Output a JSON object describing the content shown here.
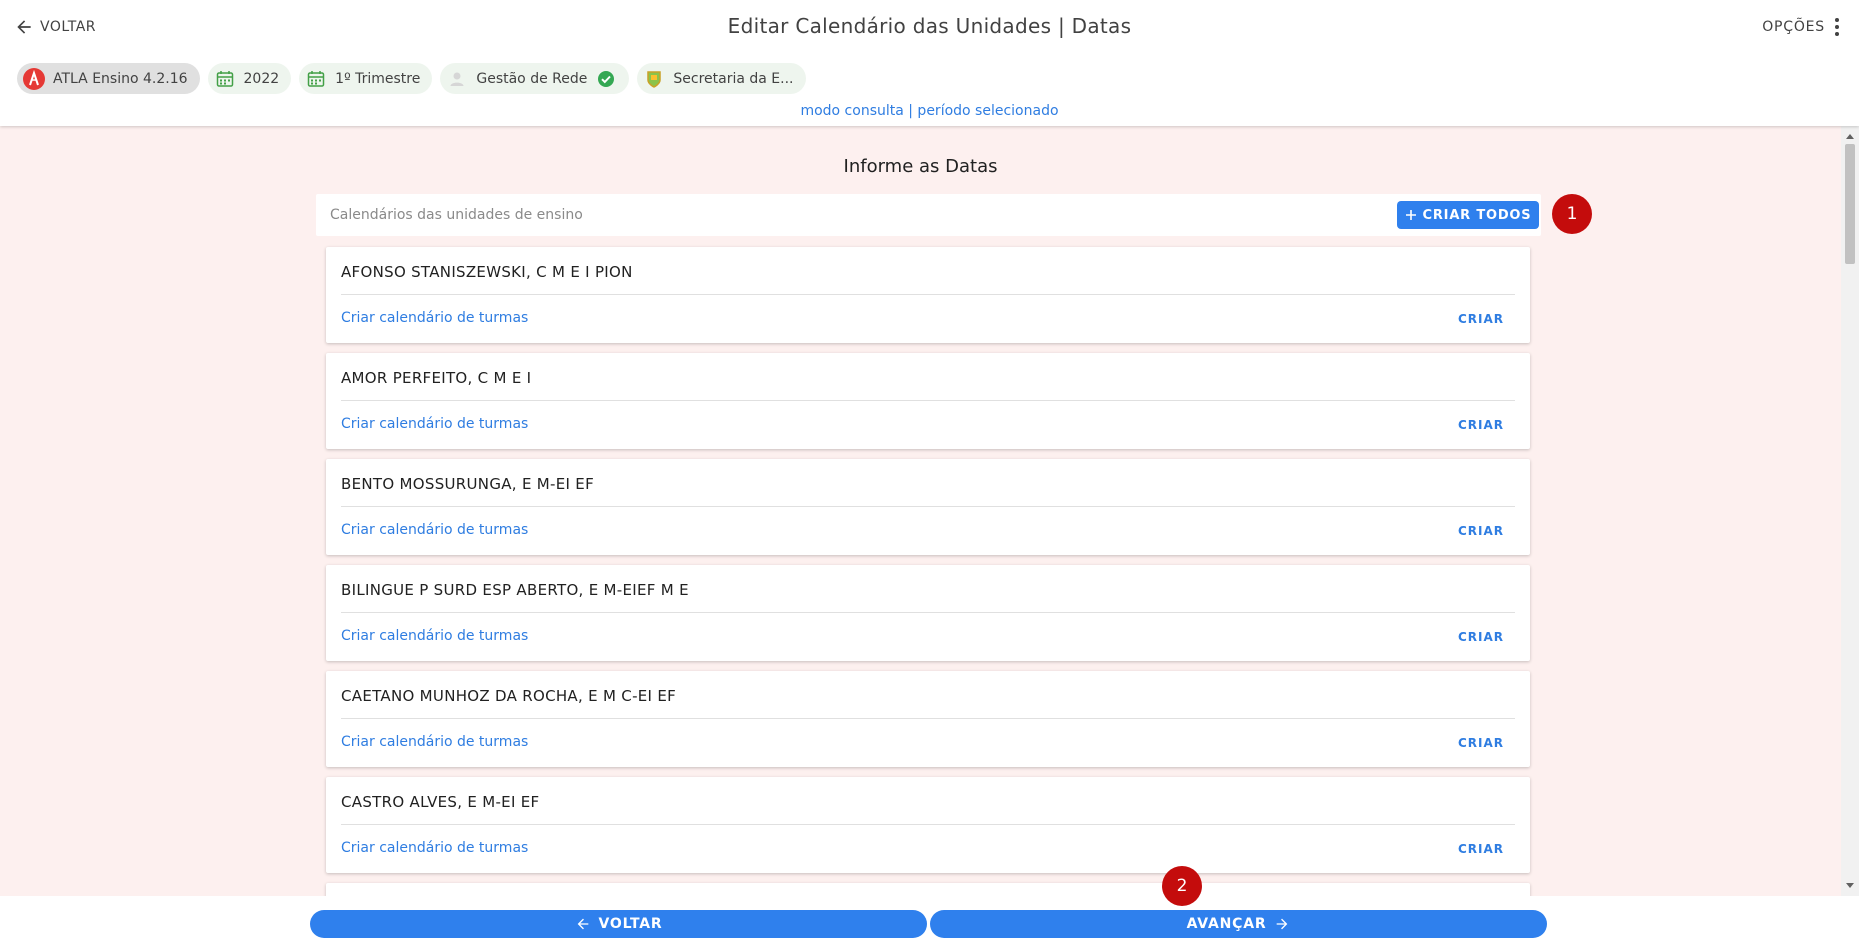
{
  "header": {
    "back_label": "VOLTAR",
    "title": "Editar Calendário das Unidades | Datas",
    "options_label": "OPÇÕES",
    "mode_link": "modo consulta | período selecionado"
  },
  "chips": [
    {
      "label": "ATLA Ensino 4.2.16",
      "icon": "atla-logo-icon"
    },
    {
      "label": "2022",
      "icon": "calendar-icon"
    },
    {
      "label": "1º Trimestre",
      "icon": "calendar-icon"
    },
    {
      "label": "Gestão de Rede",
      "icon": "person-icon",
      "status_icon": "check-circle-icon"
    },
    {
      "label": "Secretaria da E...",
      "icon": "crest-icon"
    }
  ],
  "main": {
    "section_title": "Informe as Datas",
    "search_placeholder": "Calendários das unidades de ensino",
    "criar_todos_label": "CRIAR TODOS"
  },
  "badges": [
    "1",
    "2"
  ],
  "cards": [
    {
      "title": "AFONSO STANISZEWSKI, C M E I PION",
      "link": "Criar calendário de turmas",
      "action": "CRIAR"
    },
    {
      "title": "AMOR PERFEITO, C M E I",
      "link": "Criar calendário de turmas",
      "action": "CRIAR"
    },
    {
      "title": "BENTO MOSSURUNGA, E M-EI EF",
      "link": "Criar calendário de turmas",
      "action": "CRIAR"
    },
    {
      "title": "BILINGUE P SURD ESP ABERTO, E M-EIEF M E",
      "link": "Criar calendário de turmas",
      "action": "CRIAR"
    },
    {
      "title": "CAETANO MUNHOZ DA ROCHA, E M C-EI EF",
      "link": "Criar calendário de turmas",
      "action": "CRIAR"
    },
    {
      "title": "CASTRO ALVES, E M-EI EF",
      "link": "Criar calendário de turmas",
      "action": "CRIAR"
    }
  ],
  "footer": {
    "back_label": "VOLTAR",
    "next_label": "AVANÇAR"
  },
  "colors": {
    "accent": "#2f80ed",
    "link": "#2f7de1",
    "badge": "#c40c0c",
    "background": "#fdf0ef"
  }
}
